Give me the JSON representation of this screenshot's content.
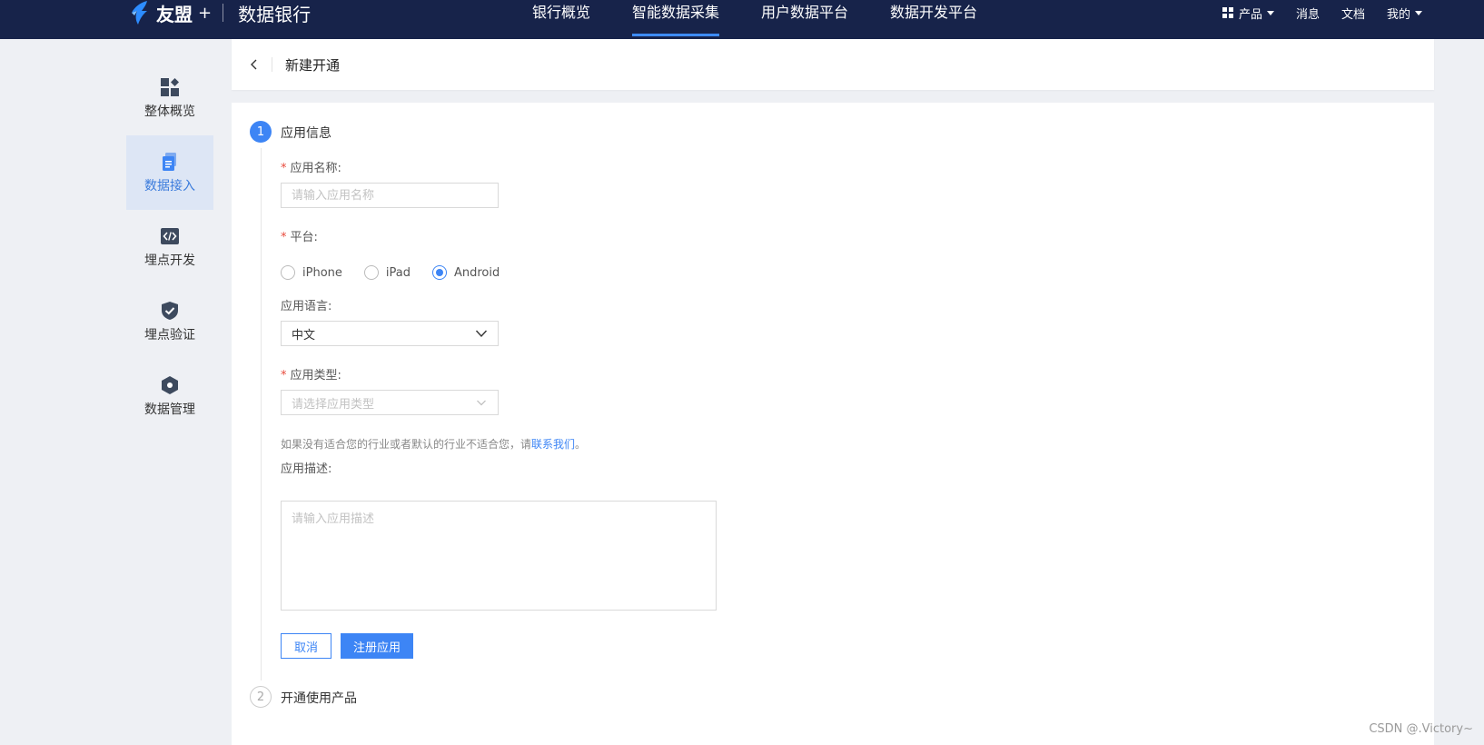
{
  "topbar": {
    "brand": "友盟",
    "brand_plus": "+",
    "product": "数据银行",
    "nav": [
      {
        "label": "银行概览"
      },
      {
        "label": "智能数据采集"
      },
      {
        "label": "用户数据平台"
      },
      {
        "label": "数据开发平台"
      }
    ],
    "active_nav": 1,
    "right": {
      "products": "产品",
      "messages": "消息",
      "docs": "文档",
      "mine": "我的"
    }
  },
  "sidebar": {
    "items": [
      {
        "label": "整体概览",
        "icon": "dashboard-icon"
      },
      {
        "label": "数据接入",
        "icon": "document-icon"
      },
      {
        "label": "埋点开发",
        "icon": "code-icon"
      },
      {
        "label": "埋点验证",
        "icon": "shield-check-icon"
      },
      {
        "label": "数据管理",
        "icon": "hexagon-icon"
      }
    ],
    "active": 1
  },
  "header": {
    "title": "新建开通"
  },
  "form": {
    "step1": {
      "number": "1",
      "title": "应用信息"
    },
    "step2": {
      "number": "2",
      "title": "开通使用产品"
    },
    "app_name": {
      "label": "应用名称:",
      "placeholder": "请输入应用名称"
    },
    "platform": {
      "label": "平台:",
      "options": [
        "iPhone",
        "iPad",
        "Android"
      ],
      "selected": "Android"
    },
    "language": {
      "label": "应用语言:",
      "value": "中文"
    },
    "app_type": {
      "label": "应用类型:",
      "placeholder": "请选择应用类型"
    },
    "hint": {
      "text": "如果没有适合您的行业或者默认的行业不适合您，请",
      "link": "联系我们",
      "suffix": "。"
    },
    "description": {
      "label": "应用描述:",
      "placeholder": "请输入应用描述"
    },
    "buttons": {
      "cancel": "取消",
      "submit": "注册应用"
    }
  },
  "watermark": "CSDN @.Victory~",
  "colors": {
    "topbar_bg": "#17234a",
    "accent": "#3d85f5",
    "required": "#e84a3c",
    "sidebar_active_bg": "#dde6f5"
  }
}
